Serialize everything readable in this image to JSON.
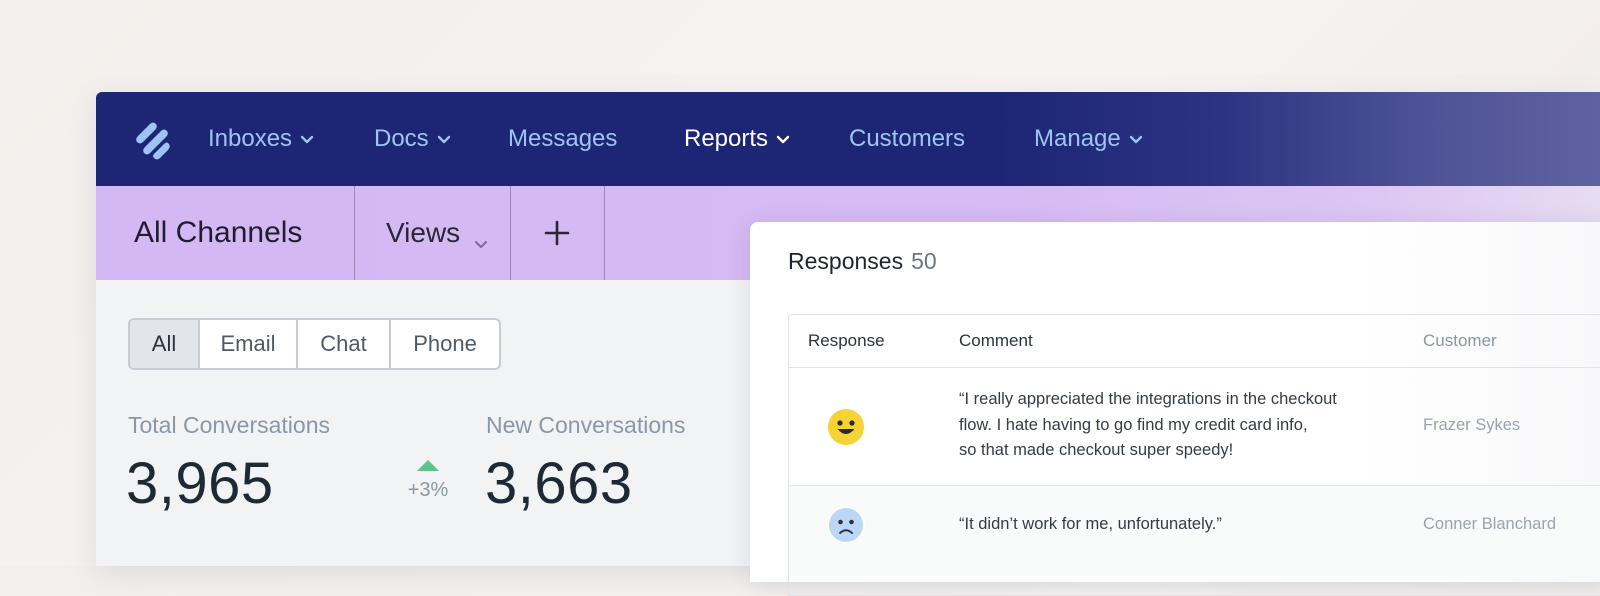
{
  "nav": {
    "items": [
      {
        "label": "Inboxes",
        "dropdown": true
      },
      {
        "label": "Docs",
        "dropdown": true
      },
      {
        "label": "Messages",
        "dropdown": false
      },
      {
        "label": "Reports",
        "dropdown": true,
        "active": true
      },
      {
        "label": "Customers",
        "dropdown": false
      },
      {
        "label": "Manage",
        "dropdown": true
      }
    ]
  },
  "subbar": {
    "title": "All Channels",
    "views_label": "Views"
  },
  "filters": {
    "options": [
      "All",
      "Email",
      "Chat",
      "Phone"
    ],
    "selected": "All"
  },
  "stats": {
    "total": {
      "label": "Total Conversations",
      "value": "3,965"
    },
    "trend": {
      "label": "+3%",
      "direction": "up"
    },
    "new": {
      "label": "New Conversations",
      "value": "3,663"
    }
  },
  "responses": {
    "title": "Responses",
    "count": "50",
    "columns": {
      "response": "Response",
      "comment": "Comment",
      "customer": "Customer"
    },
    "rows": [
      {
        "rating": "happy-face-icon",
        "comment": "“I really appreciated the integrations in the checkout\nflow. I hate having to go find my credit card info,\nso that made checkout super speedy!",
        "customer": "Frazer Sykes"
      },
      {
        "rating": "sad-face-icon",
        "comment": "“It didn’t work for me, unfortunately.”",
        "customer": "Conner Blanchard"
      }
    ]
  },
  "colors": {
    "nav_bg": "#1d2675",
    "nav_text": "#9ec3f4",
    "subbar_bg": "#d4b8f3",
    "trend_up": "#5cc48c",
    "happy_face": "#f5d236",
    "sad_face": "#bcd6f7"
  }
}
